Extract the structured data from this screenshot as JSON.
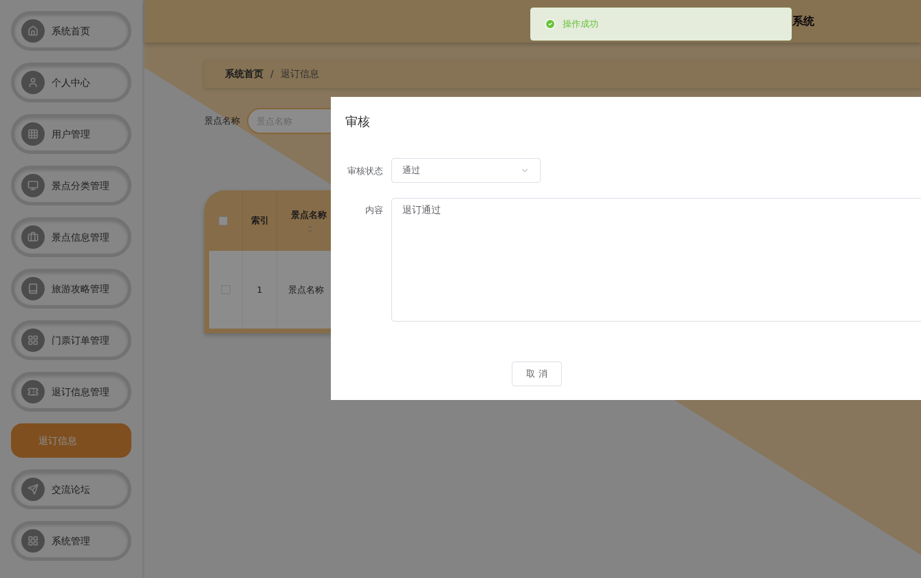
{
  "header": {
    "title": "系统"
  },
  "toast": {
    "kind": "success",
    "message": "操作成功"
  },
  "sidebar": {
    "items": [
      {
        "label": "系统首页",
        "selected": false
      },
      {
        "label": "个人中心",
        "selected": false
      },
      {
        "label": "用户管理",
        "selected": false
      },
      {
        "label": "景点分类管理",
        "selected": false
      },
      {
        "label": "景点信息管理",
        "selected": false
      },
      {
        "label": "旅游攻略管理",
        "selected": false
      },
      {
        "label": "门票订单管理",
        "selected": false
      },
      {
        "label": "退订信息管理",
        "selected": false,
        "children": [
          {
            "label": "退订信息",
            "selected": true
          }
        ]
      },
      {
        "label": "交流论坛",
        "selected": false
      },
      {
        "label": "系统管理",
        "selected": false
      }
    ]
  },
  "breadcrumb": {
    "items": [
      "系统首页",
      "退订信息"
    ],
    "separator": "/"
  },
  "search": {
    "label": "景点名称",
    "placeholder": "景点名称"
  },
  "table": {
    "select_all_checked": false,
    "columns": [
      {
        "label": "索引"
      },
      {
        "label": "景点名称",
        "sortable": true
      }
    ],
    "rows": [
      {
        "checked": false,
        "cells": [
          "1",
          "景点名称"
        ]
      }
    ]
  },
  "dialog": {
    "title": "审核",
    "fields": [
      {
        "kind": "select",
        "label": "审核状态",
        "value": "通过"
      },
      {
        "kind": "textarea",
        "label": "内容",
        "value": "退订通过"
      }
    ],
    "buttons": [
      "取 消"
    ]
  }
}
